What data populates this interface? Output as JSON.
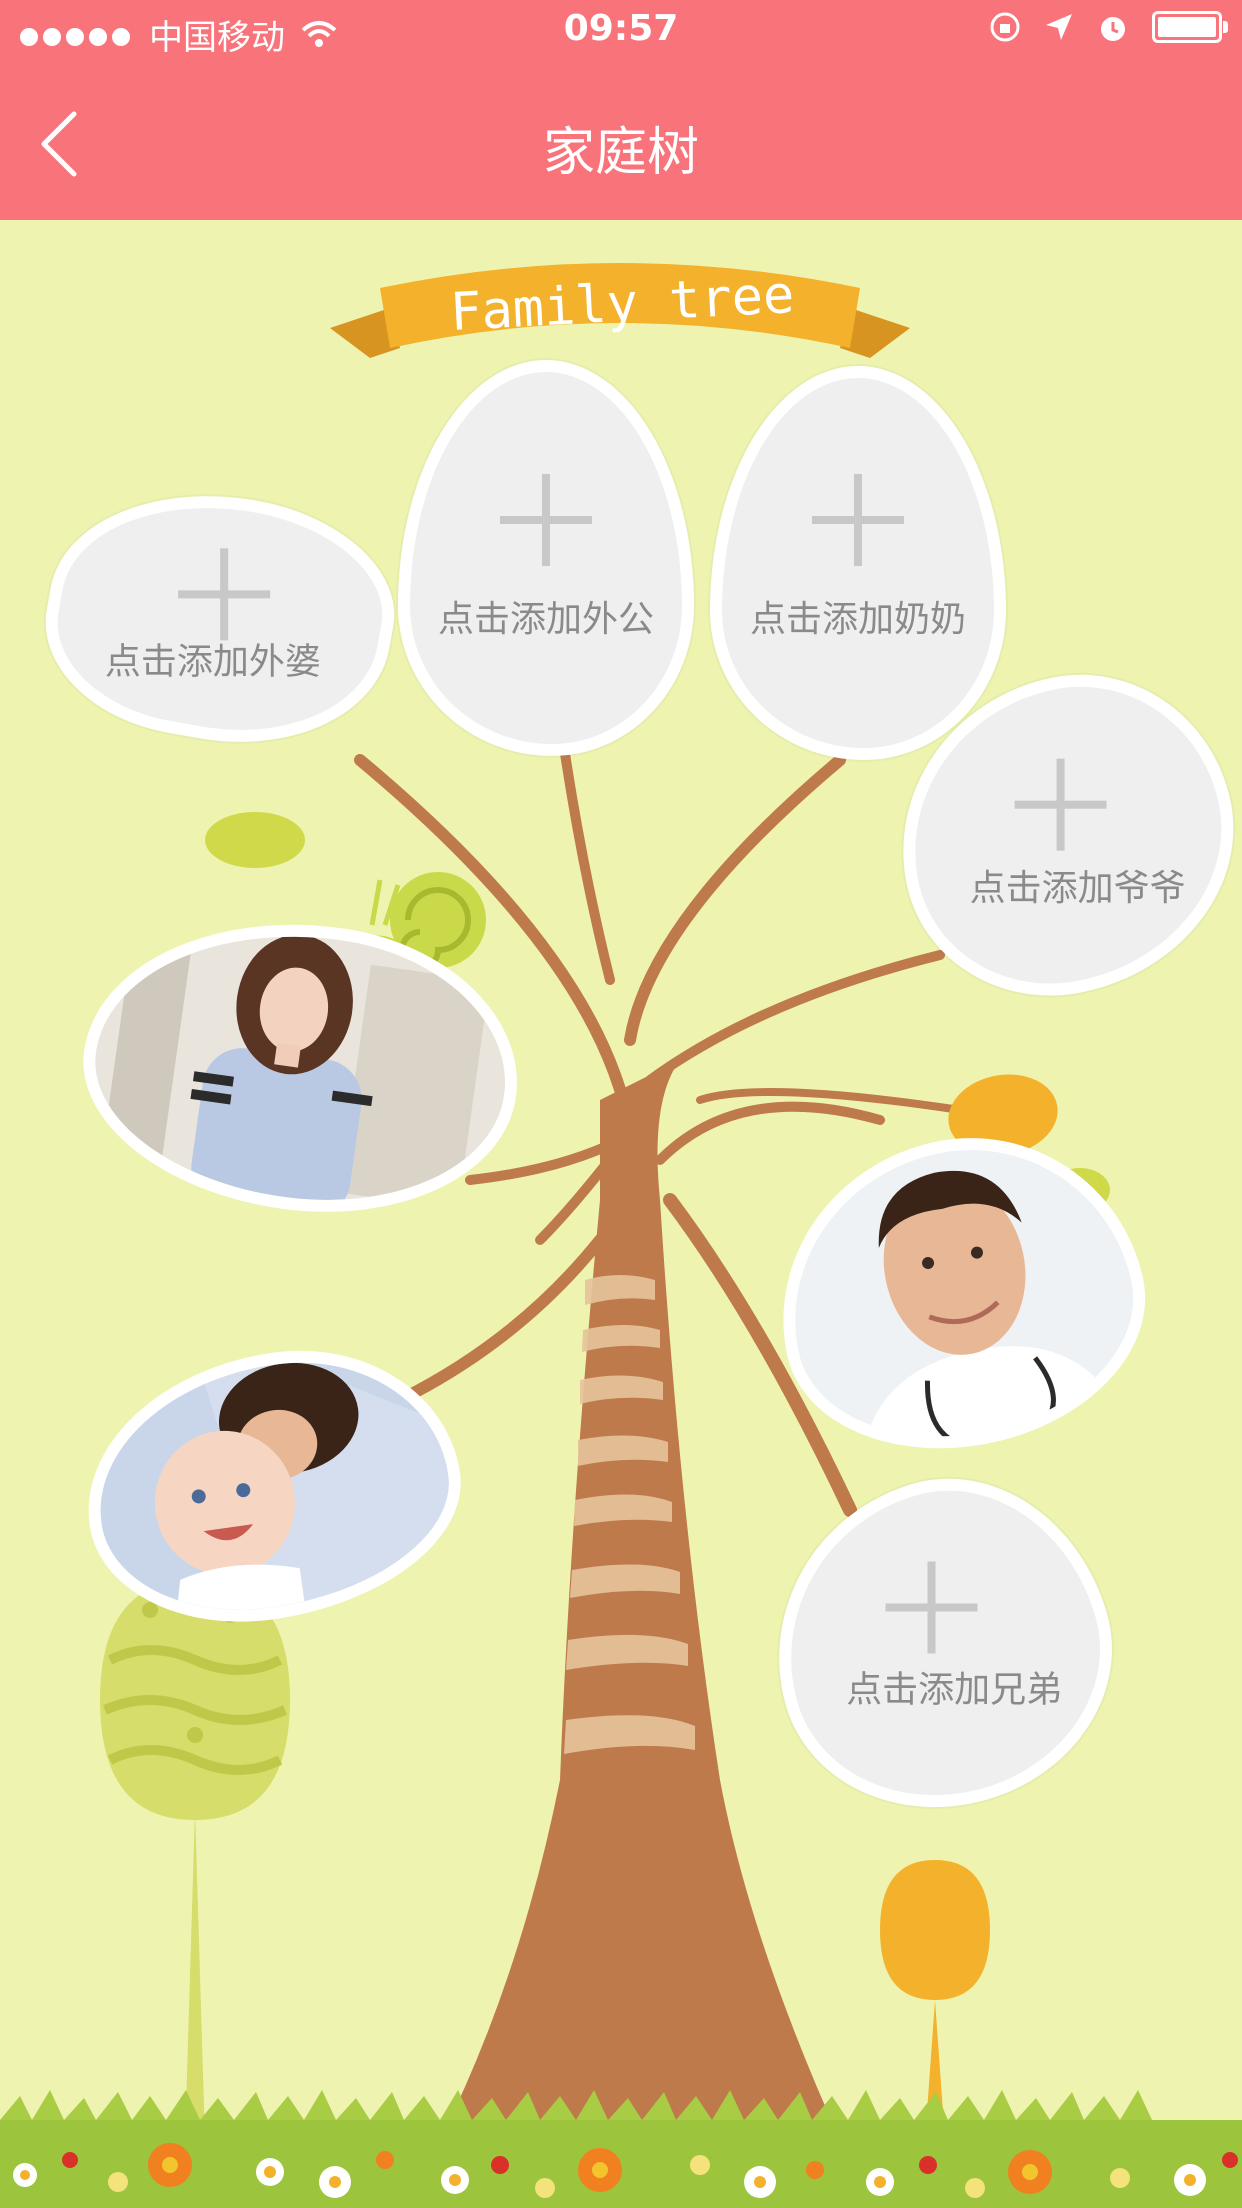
{
  "status_bar": {
    "carrier": "中国移动",
    "time": "09:57"
  },
  "nav": {
    "title": "家庭树"
  },
  "banner": {
    "text": "Family tree"
  },
  "slots": {
    "maternal_grandmother": "点击添加外婆",
    "maternal_grandfather": "点击添加外公",
    "paternal_grandmother": "点击添加奶奶",
    "paternal_grandfather": "点击添加爷爷",
    "brother": "点击添加兄弟"
  },
  "colors": {
    "header": "#f9737b",
    "background": "#eef4b0",
    "trunk": "#bf7a4c",
    "banner": "#f3b12c"
  }
}
